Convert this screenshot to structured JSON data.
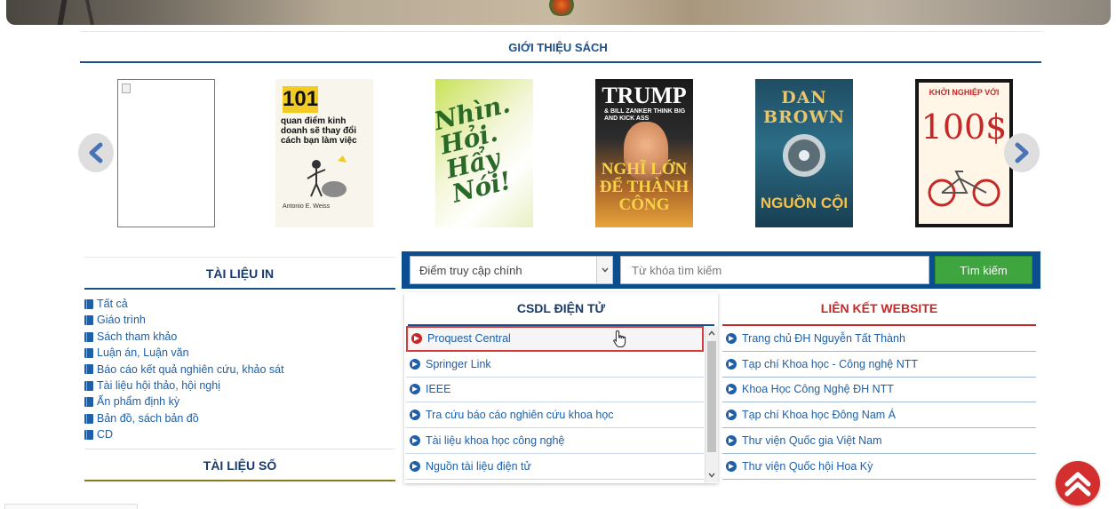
{
  "book_intro": {
    "title": "GIỚI THIỆU SÁCH",
    "books": [
      {
        "cover": "blank"
      },
      {
        "cover_text": {
          "num": "101",
          "line": "quan điểm kinh doanh sẽ thay đổi cách bạn làm việc",
          "author": "Antonio E. Weiss"
        }
      },
      {
        "cover_text": {
          "line": "Nhìn. Hỏi. Hẩy Nói!"
        }
      },
      {
        "cover_text": {
          "title": "TRUMP",
          "sub": "& BILL ZANKER THINK BIG AND KICK ASS",
          "big": "NGHĨ LỚN ĐỂ THÀNH CÔNG"
        }
      },
      {
        "cover_text": {
          "title": "DAN BROWN",
          "bottom": "NGUỒN CỘI"
        }
      },
      {
        "cover_text": {
          "top": "KHỞI NGHIỆP VỚI",
          "num": "100$"
        }
      }
    ]
  },
  "left": {
    "print_title": "TÀI LIỆU IN",
    "print_items": [
      "Tất cả",
      "Giáo trình",
      "Sách tham khảo",
      "Luận án, Luận văn",
      "Báo cáo kết quả nghiên cứu, khảo sát",
      "Tài liệu hội thảo, hội nghị",
      "Ấn phẩm định kỳ",
      "Bản đồ, sách bản đồ",
      "CD"
    ],
    "digital_title": "TÀI LIỆU SỐ"
  },
  "search": {
    "select_value": "Điểm truy cập chính",
    "placeholder": "Từ khóa tìm kiếm",
    "button": "Tìm kiếm"
  },
  "databases": {
    "title": "CSDL ĐIỆN TỬ",
    "items": [
      "Proquest Central",
      "Springer Link",
      "IEEE",
      "Tra cứu báo cáo nghiên cứu khoa học",
      "Tài liệu khoa học công nghệ",
      "Nguồn tài liệu điện tử"
    ]
  },
  "links": {
    "title": "LIÊN KẾT WEBSITE",
    "items": [
      "Trang chủ ĐH Nguyễn Tất Thành",
      "Tạp chí Khoa học - Công nghệ NTT",
      "Khoa Học Công Nghệ ĐH NTT",
      "Tạp chí Khoa học Đông Nam Á",
      "Thư viện Quốc gia Việt Nam",
      "Thư viện Quốc hội Hoa Kỳ"
    ]
  },
  "colors": {
    "primary": "#1a4f8b",
    "accent_red": "#c62828",
    "search_green": "#3fa53f"
  }
}
